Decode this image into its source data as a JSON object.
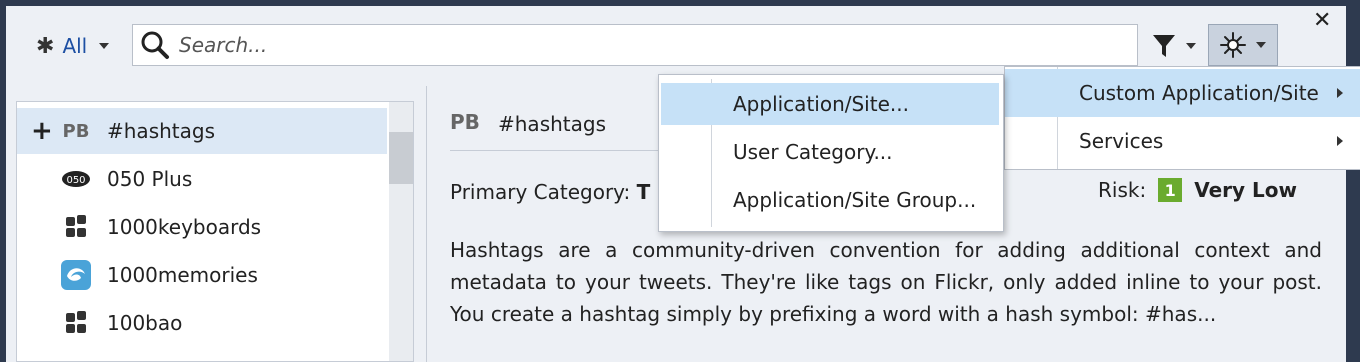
{
  "toolbar": {
    "filter_label": "All",
    "search_placeholder": "Search..."
  },
  "list": {
    "items": [
      {
        "label": "#hashtags",
        "icon": "pb-logo-icon",
        "icon_text": "PB",
        "selected": true
      },
      {
        "label": "050 Plus",
        "icon": "050plus-logo-icon"
      },
      {
        "label": "1000keyboards",
        "icon": "app-blocks-icon"
      },
      {
        "label": "1000memories",
        "icon": "1000memories-logo-icon"
      },
      {
        "label": "100bao",
        "icon": "app-blocks-icon"
      }
    ]
  },
  "detail": {
    "logo_text": "PB",
    "title": "#hashtags",
    "primary_category_label": "Primary Category:",
    "primary_category_value": "T",
    "risk_label": "Risk:",
    "risk_level_number": "1",
    "risk_level_text": "Very Low",
    "description": "Hashtags are a community-driven convention for adding additional context and metadata to your tweets. They're like tags on Flickr, only added inline to your post. You create a hashtag simply by prefixing a word with a hash symbol: #has..."
  },
  "submenu": {
    "items": [
      {
        "label": "Application/Site..."
      },
      {
        "label": "User Category..."
      },
      {
        "label": "Application/Site Group..."
      }
    ]
  },
  "menu": {
    "items": [
      {
        "label": "Custom Application/Site"
      },
      {
        "label": "Services"
      }
    ]
  },
  "colors": {
    "accent": "#1d4fa3",
    "selection": "#dce8f5",
    "menu_highlight": "#c6e1f7",
    "risk_green": "#6aab2e"
  }
}
